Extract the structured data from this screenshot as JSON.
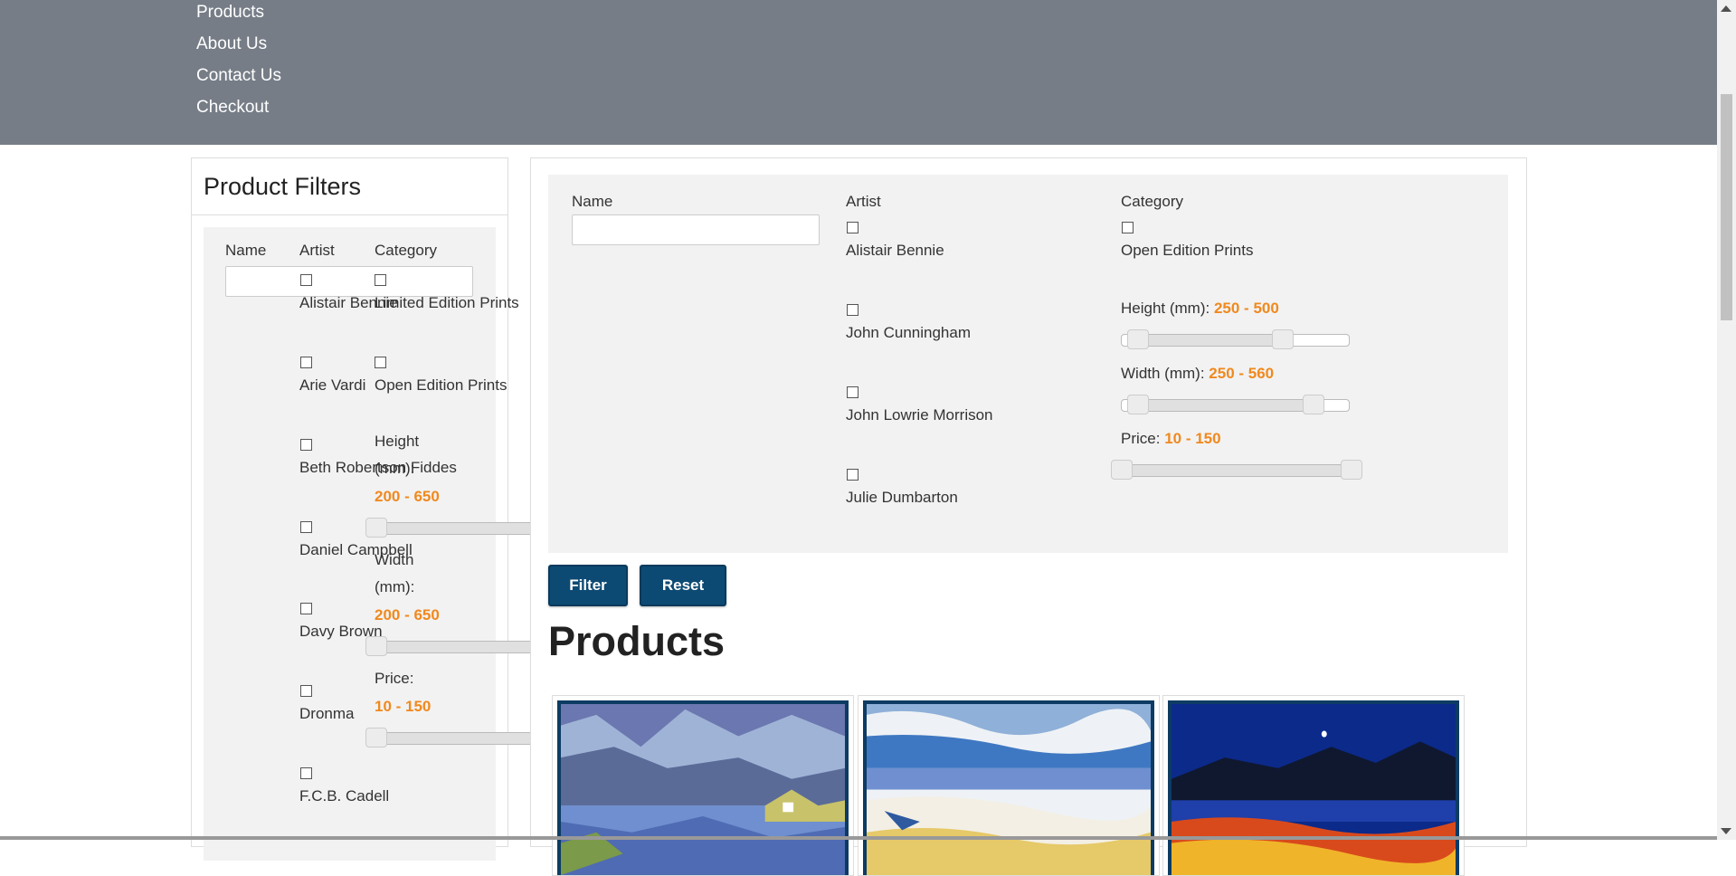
{
  "nav": {
    "items": [
      "Products",
      "About Us",
      "Contact Us",
      "Checkout"
    ]
  },
  "sidebar": {
    "title": "Product Filters",
    "name_label": "Name",
    "artist_label": "Artist",
    "category_label": "Category",
    "artists": [
      "Alistair Bennie",
      "Arie Vardi",
      "Beth Robertson Fiddes",
      "Daniel Campbell",
      "Davy Brown",
      "Dronma",
      "F.C.B. Cadell"
    ],
    "categories": [
      "Limited Edition Prints",
      "Open Edition Prints"
    ],
    "height_label_1": "Height",
    "height_label_2": "(mm):",
    "height_range": "200 - 650",
    "width_label_1": "Width",
    "width_label_2": "(mm):",
    "width_range": "200 - 650",
    "price_label": "Price:",
    "price_range": "10 - 150"
  },
  "main": {
    "name_label": "Name",
    "name_placeholder": "",
    "artist_label": "Artist",
    "category_label": "Category",
    "artists": [
      "Alistair Bennie",
      "John Cunningham",
      "John Lowrie Morrison",
      "Julie Dumbarton"
    ],
    "categories": [
      "Open Edition Prints"
    ],
    "height_label": "Height (mm): ",
    "height_range": "250 - 500",
    "width_label": "Width (mm): ",
    "width_range": "250 - 560",
    "price_label": "Price: ",
    "price_range": "10 - 150",
    "filter_button": "Filter",
    "reset_button": "Reset",
    "products_heading": "Products"
  },
  "colors": {
    "navbar": "#767d87",
    "button": "#0d4a73",
    "range_value": "#f0891e",
    "card_frame": "#0d3b63"
  }
}
